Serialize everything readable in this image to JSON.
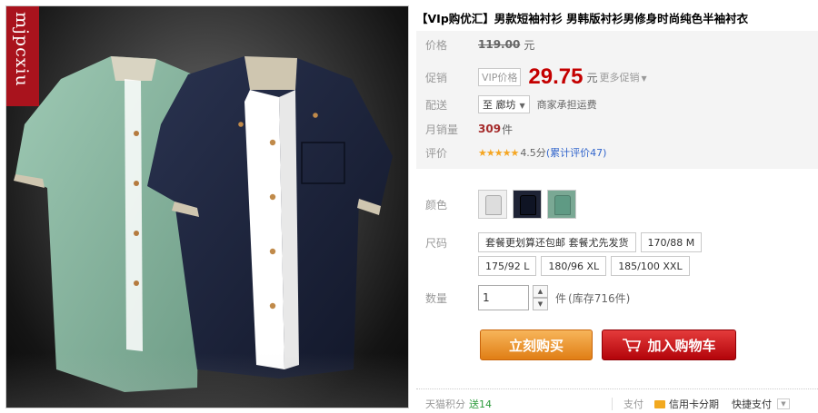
{
  "image": {
    "brand_text": "mjpcxiu",
    "description_icon": "shirt-product-photo"
  },
  "title": "【VIp购优汇】男款短袖衬衫 男韩版衬衫男修身时尚纯色半袖衬衣",
  "price": {
    "label": "价格",
    "original": "119.00",
    "unit": "元"
  },
  "promo": {
    "label": "促销",
    "vip_tag": "VIP价格",
    "price": "29.75",
    "unit": "元",
    "more": "更多促销"
  },
  "delivery": {
    "label": "配送",
    "location": "至 廊坊",
    "note": "商家承担运费"
  },
  "monthly_sales": {
    "label": "月销量",
    "value": "309",
    "unit": "件"
  },
  "rating": {
    "label": "评价",
    "stars": "★★★★★",
    "score": "4.5分",
    "reviews": "(累计评价47)",
    "rating_value": 4.5
  },
  "color": {
    "label": "颜色",
    "swatches": [
      "white-shirt",
      "navy-shirt",
      "green-shirt"
    ]
  },
  "size": {
    "label": "尺码",
    "options": [
      "套餐更划算还包邮 套餐尤先发货",
      "170/88 M",
      "175/92 L",
      "180/96 XL",
      "185/100 XXL"
    ]
  },
  "quantity": {
    "label": "数量",
    "value": "1",
    "unit": "件",
    "stock": "(库存716件)"
  },
  "actions": {
    "buy_now": "立刻购买",
    "add_to_cart": "加入购物车"
  },
  "footer": {
    "points_label": "天猫积分",
    "points_value": "送14",
    "pay_label": "支付",
    "credit": "信用卡分期",
    "quick_pay": "快捷支付"
  },
  "colors": {
    "accent_red": "#c40000",
    "buy_orange": "#e07e15",
    "cart_red": "#b3040a",
    "brand_strip": "#a9131d"
  }
}
